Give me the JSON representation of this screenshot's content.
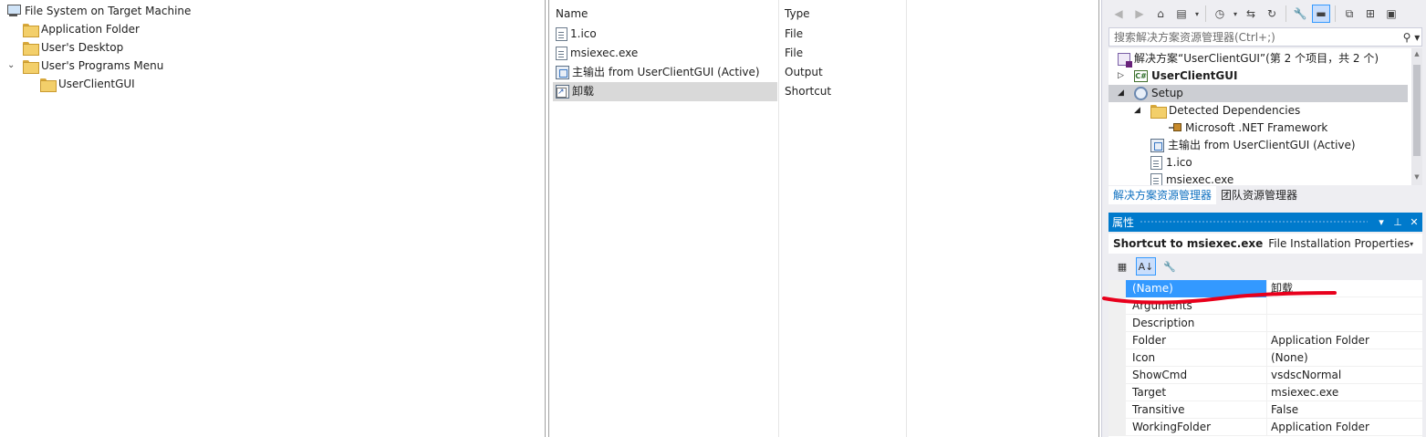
{
  "file_system": {
    "root": "File System on Target Machine",
    "nodes": [
      {
        "label": "Application Folder"
      },
      {
        "label": "User's Desktop"
      },
      {
        "label": "User's Programs Menu"
      },
      {
        "label": "UserClientGUI"
      }
    ]
  },
  "file_list": {
    "columns": {
      "name": "Name",
      "type": "Type"
    },
    "rows": [
      {
        "name": "1.ico",
        "type": "File",
        "icon": "file-icon"
      },
      {
        "name": "msiexec.exe",
        "type": "File",
        "icon": "file-icon"
      },
      {
        "name": "主输出 from UserClientGUI (Active)",
        "type": "Output",
        "icon": "output-icon"
      },
      {
        "name": "卸载",
        "type": "Shortcut",
        "icon": "shortcut-icon",
        "selected": true
      }
    ]
  },
  "solution_explorer": {
    "search_placeholder": "搜索解决方案资源管理器(Ctrl+;)",
    "items": [
      {
        "label": "解决方案“UserClientGUI”(第 2 个项目，共 2 个)"
      },
      {
        "label": "UserClientGUI"
      },
      {
        "label": "Setup"
      },
      {
        "label": "Detected Dependencies"
      },
      {
        "label": "Microsoft .NET Framework"
      },
      {
        "label": "主输出 from UserClientGUI (Active)"
      },
      {
        "label": "1.ico"
      },
      {
        "label": "msiexec.exe"
      }
    ],
    "tabs": [
      {
        "label": "解决方案资源管理器"
      },
      {
        "label": "团队资源管理器"
      }
    ]
  },
  "properties": {
    "title": "属性",
    "object_name": "Shortcut to msiexec.exe",
    "object_type": "File Installation Properties",
    "rows": [
      {
        "name": "(Name)",
        "value": "卸载",
        "selected": true
      },
      {
        "name": "Arguments",
        "value": ""
      },
      {
        "name": "Description",
        "value": ""
      },
      {
        "name": "Folder",
        "value": "Application Folder"
      },
      {
        "name": "Icon",
        "value": "(None)"
      },
      {
        "name": "ShowCmd",
        "value": "vsdscNormal"
      },
      {
        "name": "Target",
        "value": "msiexec.exe"
      },
      {
        "name": "Transitive",
        "value": "False"
      },
      {
        "name": "WorkingFolder",
        "value": "Application Folder"
      }
    ]
  },
  "colors": {
    "accent": "#007acc",
    "selection": "#3399ff",
    "annotation_red": "#e8001c"
  }
}
